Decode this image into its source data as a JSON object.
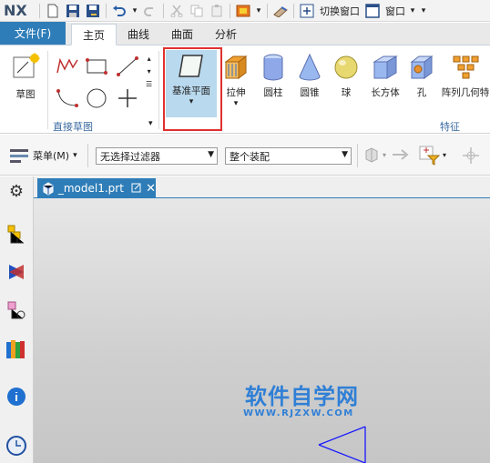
{
  "app": {
    "logo": "NX"
  },
  "quick_access": {
    "switch_window": "切换窗口",
    "window_menu": "窗口",
    "dropdown": "▾"
  },
  "tabs": [
    {
      "label": "文件(F)"
    },
    {
      "label": "主页"
    },
    {
      "label": "曲线"
    },
    {
      "label": "曲面"
    },
    {
      "label": "分析"
    }
  ],
  "ribbon": {
    "sketch": "草图",
    "direct_sketch_group": "直接草图",
    "datum_plane": "基准平面",
    "extrude": "拉伸",
    "cylinder": "圆柱",
    "cone": "圆锥",
    "sphere": "球",
    "block": "长方体",
    "hole": "孔",
    "pattern_geometry": "阵列几何特",
    "feature_group": "特征"
  },
  "toolbar": {
    "menu_label": "菜单(M)",
    "filter_value": "无选择过滤器",
    "assembly_value": "整个装配"
  },
  "document": {
    "tab_title": "_model1.prt"
  },
  "watermark": {
    "title": "软件自学网",
    "url": "WWW.RJZXW.COM"
  },
  "colors": {
    "accent": "#2e7db8",
    "highlight": "#e03030",
    "watermark": "#2f7fd6"
  }
}
